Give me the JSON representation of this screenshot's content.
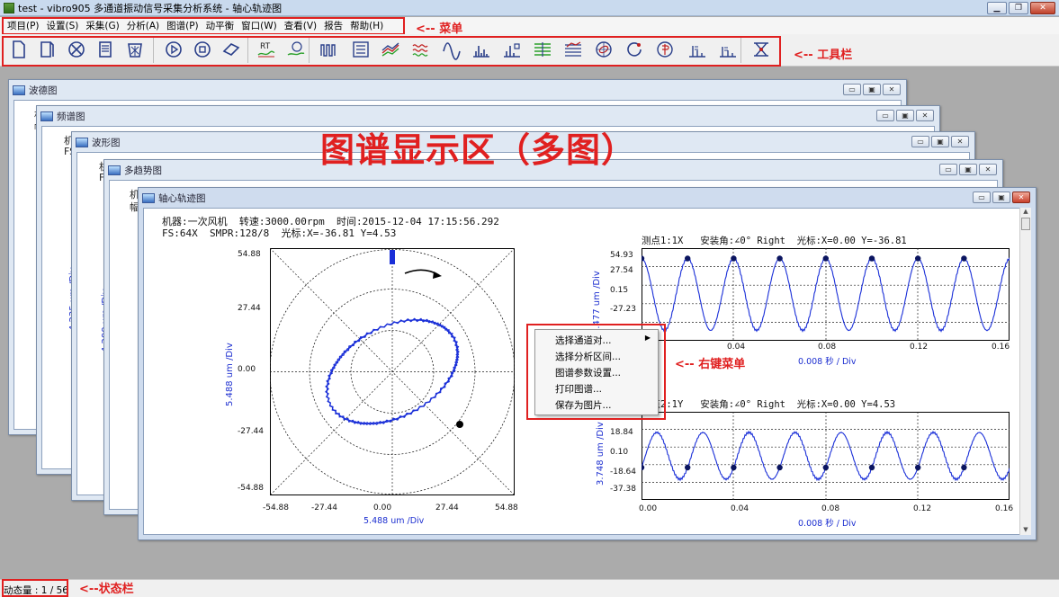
{
  "window": {
    "title": "test - vibro905 多通道振动信号采集分析系统 - 轴心轨迹图"
  },
  "menu": {
    "items": [
      "项目(P)",
      "设置(S)",
      "采集(G)",
      "分析(A)",
      "图谱(P)",
      "动平衡",
      "窗口(W)",
      "查看(V)",
      "报告",
      "帮助(H)"
    ]
  },
  "annotations": {
    "menu": "<-- 菜单",
    "toolbar": "<-- 工具栏",
    "display_area": "图谱显示区（多图）",
    "context_menu": "<-- 右键菜单",
    "status": "<--状态栏"
  },
  "toolbar": {
    "icons": [
      "new-file-icon",
      "open-file-icon",
      "cancel-icon",
      "document-icon",
      "delete-icon",
      "play-icon",
      "stop-icon",
      "tag-icon",
      "rt-icon",
      "timer-icon",
      "pulse-icon",
      "list-icon",
      "multi-trend-icon",
      "waterfall-icon",
      "wave-icon",
      "spectrum-icon",
      "spectrum-lock-icon",
      "lines-icon",
      "cascade-icon",
      "orbit-icon",
      "rotate-icon",
      "phase-icon",
      "bode-icon",
      "bode2-icon",
      "balance-icon"
    ],
    "rt": "RT"
  },
  "windows": [
    {
      "title": "波德图",
      "stub": [
        "机",
        "幅"
      ],
      "rot": ""
    },
    {
      "title": "频谱图",
      "stub": [
        "机",
        "FS"
      ],
      "rot": "4.235 um /Div"
    },
    {
      "title": "波形图",
      "stub": [
        "机",
        "F"
      ],
      "rot": "4.200 um /Div"
    },
    {
      "title": "多趋势图",
      "stub": [
        "机",
        "幅"
      ],
      "rot": ""
    },
    {
      "title": "轴心轨迹图"
    }
  ],
  "orbit": {
    "info1": "机器:一次风机  转速:3000.00rpm  时间:2015-12-04 17:15:56.292",
    "info2": "FS:64X  SMPR:128/8  光标:X=-36.81 Y=4.53",
    "yticks": [
      "54.88",
      "27.44",
      "0.00",
      "-27.44",
      "-54.88"
    ],
    "xticks": [
      "-54.88",
      "-27.44",
      "0.00",
      "27.44",
      "54.88"
    ],
    "ylabel": "5.488 um /Div",
    "xlabel": "5.488 um /Div"
  },
  "wave1": {
    "header": "测点1:1X   安装角:∠0° Right  光标:X=0.00 Y=-36.81",
    "yticks": [
      "54.93",
      "27.54",
      "0.15",
      "-27.23"
    ],
    "ylabel": "5.477 um /Div",
    "xticks": [
      "0.04",
      "0.08",
      "0.12",
      "0.16"
    ],
    "xlabel": "0.008 秒 / Div"
  },
  "wave2": {
    "header": "测点2:1Y   安装角:∠0° Right  光标:X=0.00 Y=4.53",
    "yticks": [
      "18.84",
      "0.10",
      "-18.64",
      "-37.38"
    ],
    "ylabel": "3.748 um /Div",
    "xticks": [
      "0.00",
      "0.04",
      "0.08",
      "0.12",
      "0.16"
    ],
    "xlabel": "0.008 秒 / Div"
  },
  "context_menu": {
    "items": [
      "选择通道对...",
      "选择分析区间...",
      "图谱参数设置...",
      "打印图谱...",
      "保存为图片..."
    ]
  },
  "status": {
    "text": "动态量 : 1 / 56"
  }
}
